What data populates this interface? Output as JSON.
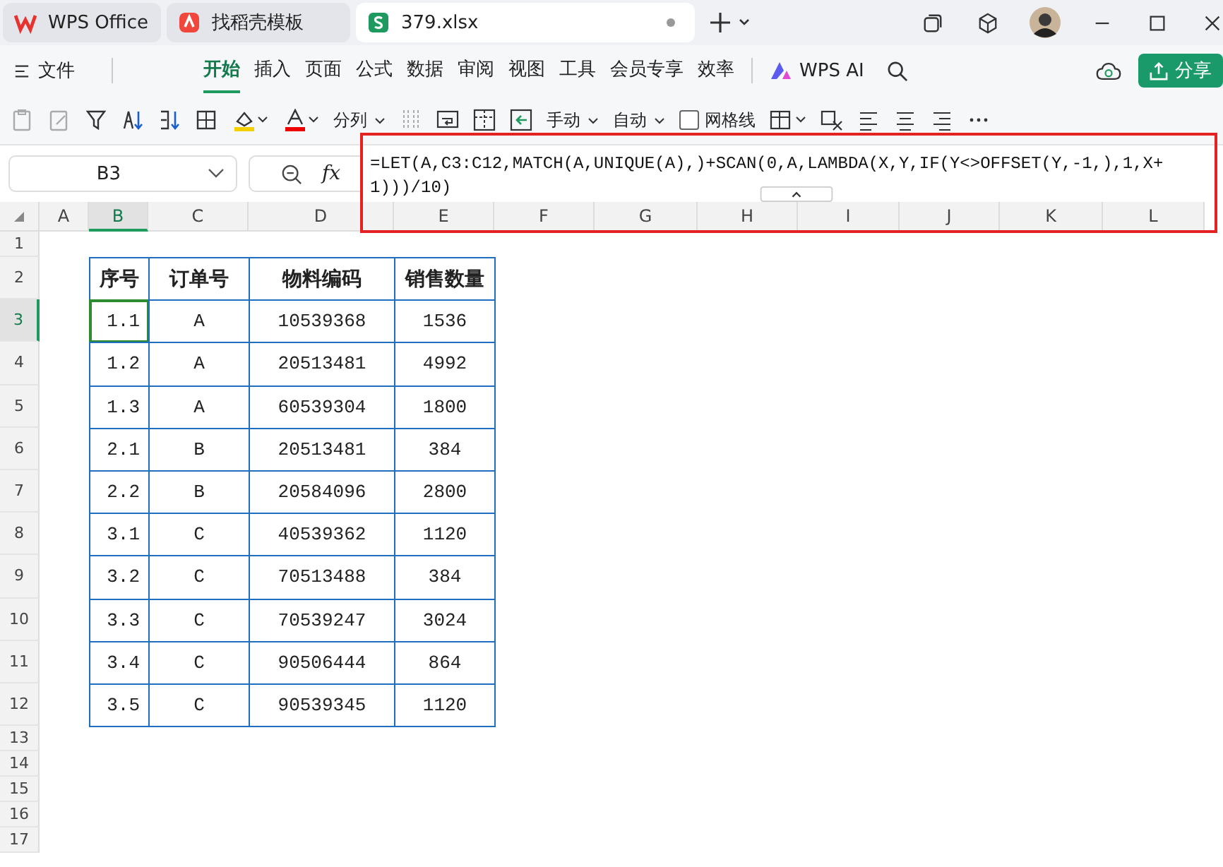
{
  "tabs": [
    {
      "label": "WPS Office",
      "selected": false,
      "kind": "wps"
    },
    {
      "label": "找稻壳模板",
      "selected": false,
      "kind": "docer"
    },
    {
      "label": "379.xlsx",
      "selected": true,
      "kind": "sheet"
    }
  ],
  "menu": {
    "file": "文件",
    "items": [
      {
        "label": "开始",
        "selected": true
      },
      {
        "label": "插入",
        "selected": false
      },
      {
        "label": "页面",
        "selected": false
      },
      {
        "label": "公式",
        "selected": false
      },
      {
        "label": "数据",
        "selected": false
      },
      {
        "label": "审阅",
        "selected": false
      },
      {
        "label": "视图",
        "selected": false
      },
      {
        "label": "工具",
        "selected": false
      },
      {
        "label": "会员专享",
        "selected": false
      },
      {
        "label": "效率",
        "selected": false
      }
    ],
    "ai": "WPS AI",
    "share": "分享"
  },
  "toolbar": {
    "split": "分列",
    "manual": "手动",
    "auto": "自动",
    "gridlines": {
      "label": "网格线",
      "checked": false
    }
  },
  "formula_bar": {
    "name_box": "B3",
    "fx": "fx",
    "formula": "=LET(A,C3:C12,MATCH(A,UNIQUE(A),)+SCAN(0,A,LAMBDA(X,Y,IF(Y<>OFFSET(Y,-1,),1,X+1)))/10)"
  },
  "columns": [
    {
      "label": "A",
      "selected": false
    },
    {
      "label": "B",
      "selected": true
    },
    {
      "label": "C",
      "selected": false
    },
    {
      "label": "D",
      "selected": false
    },
    {
      "label": "E",
      "selected": false
    },
    {
      "label": "F",
      "selected": false
    },
    {
      "label": "G",
      "selected": false
    },
    {
      "label": "H",
      "selected": false
    },
    {
      "label": "I",
      "selected": false
    },
    {
      "label": "J",
      "selected": false
    },
    {
      "label": "K",
      "selected": false
    },
    {
      "label": "L",
      "selected": false
    }
  ],
  "rows": [
    {
      "label": "1",
      "selected": false
    },
    {
      "label": "2",
      "selected": false
    },
    {
      "label": "3",
      "selected": true
    },
    {
      "label": "4",
      "selected": false
    },
    {
      "label": "5",
      "selected": false
    },
    {
      "label": "6",
      "selected": false
    },
    {
      "label": "7",
      "selected": false
    },
    {
      "label": "8",
      "selected": false
    },
    {
      "label": "9",
      "selected": false
    },
    {
      "label": "10",
      "selected": false
    },
    {
      "label": "11",
      "selected": false
    },
    {
      "label": "12",
      "selected": false
    },
    {
      "label": "13",
      "selected": false
    },
    {
      "label": "14",
      "selected": false
    },
    {
      "label": "15",
      "selected": false
    },
    {
      "label": "16",
      "selected": false
    },
    {
      "label": "17",
      "selected": false
    }
  ],
  "table": {
    "header": [
      "序号",
      "订单号",
      "物料编码",
      "销售数量"
    ],
    "rows": [
      [
        "1.1",
        "A",
        "10539368",
        "1536"
      ],
      [
        "1.2",
        "A",
        "20513481",
        "4992"
      ],
      [
        "1.3",
        "A",
        "60539304",
        "1800"
      ],
      [
        "2.1",
        "B",
        "20513481",
        "384"
      ],
      [
        "2.2",
        "B",
        "20584096",
        "2800"
      ],
      [
        "3.1",
        "C",
        "40539362",
        "1120"
      ],
      [
        "3.2",
        "C",
        "70513488",
        "384"
      ],
      [
        "3.3",
        "C",
        "70539247",
        "3024"
      ],
      [
        "3.4",
        "C",
        "90506444",
        "864"
      ],
      [
        "3.5",
        "C",
        "90539345",
        "1120"
      ]
    ]
  }
}
